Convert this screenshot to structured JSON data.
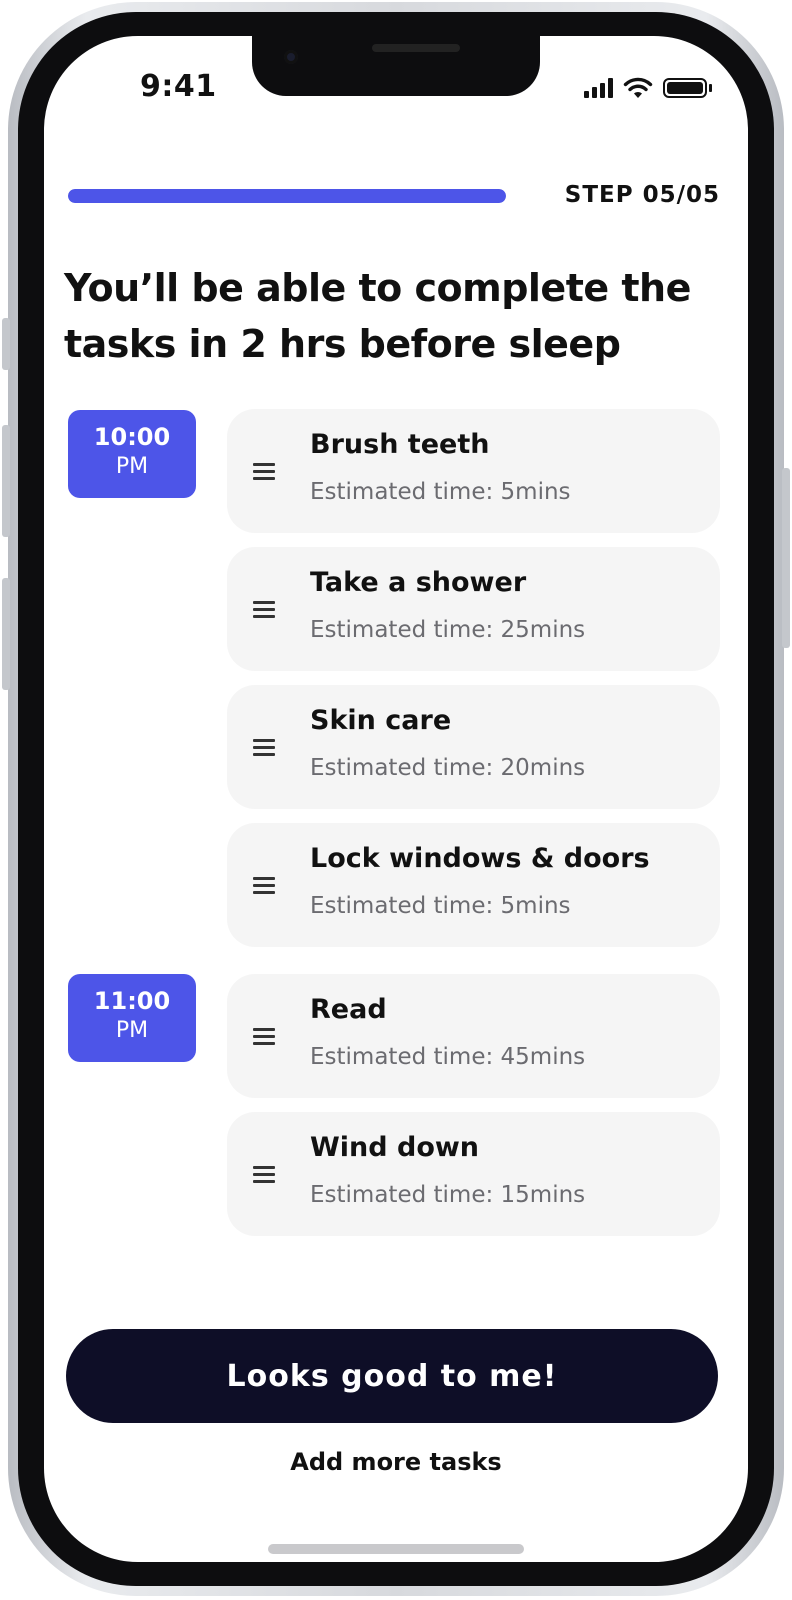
{
  "status_bar": {
    "time": "9:41"
  },
  "header": {
    "step_label": "STEP 05/05",
    "progress_fraction": 1.0
  },
  "headline": "You’ll be able to complete the tasks in 2 hrs before sleep",
  "time_slots": [
    {
      "time": "10:00",
      "period": "PM"
    },
    {
      "time": "11:00",
      "period": "PM"
    }
  ],
  "tasks": [
    {
      "title": "Brush teeth",
      "estimate": "Estimated time: 5mins"
    },
    {
      "title": "Take a shower",
      "estimate": "Estimated time: 25mins"
    },
    {
      "title": "Skin care",
      "estimate": "Estimated time: 20mins"
    },
    {
      "title": "Lock windows & doors",
      "estimate": "Estimated time: 5mins"
    },
    {
      "title": "Read",
      "estimate": "Estimated time: 45mins"
    },
    {
      "title": "Wind down",
      "estimate": "Estimated time: 15mins"
    }
  ],
  "actions": {
    "primary_label": "Looks good to me!",
    "secondary_label": "Add more tasks"
  },
  "colors": {
    "accent": "#4d55e8",
    "button_dark": "#0e0e27",
    "card_bg": "#f5f5f5"
  }
}
